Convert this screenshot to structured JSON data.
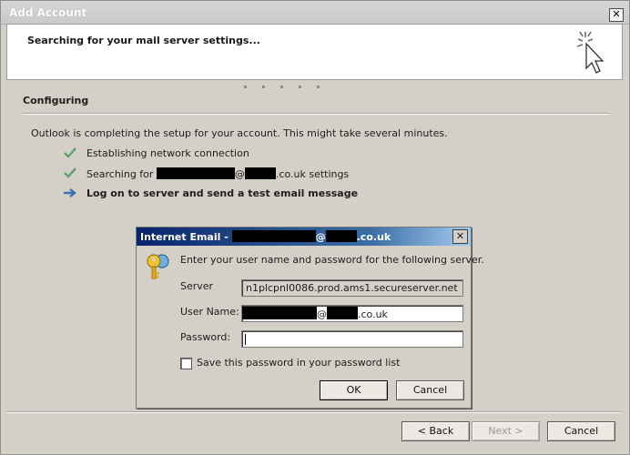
{
  "window": {
    "title": "Add Account",
    "close_glyph": "✕"
  },
  "header": {
    "heading": "Searching for your mail server settings..."
  },
  "section": {
    "title": "Configuring",
    "intro": "Outlook is completing the setup for your account. This might take several minutes."
  },
  "steps": [
    {
      "status": "done",
      "icon": "checkmark-icon",
      "text": "Establishing network connection"
    },
    {
      "status": "done",
      "icon": "checkmark-icon",
      "text_before": "Searching for ",
      "at": "@",
      "text_after": ".co.uk settings"
    },
    {
      "status": "current",
      "icon": "arrow-right-icon",
      "text": "Log on to server and send a test email message"
    }
  ],
  "buttons": {
    "back": "< Back",
    "next": "Next >",
    "cancel": "Cancel"
  },
  "dialog": {
    "title_prefix": "Internet Email - ",
    "title_at": "@",
    "title_suffix": ".co.uk",
    "close_glyph": "✕",
    "prompt": "Enter your user name and password for the following server.",
    "server_label": "Server",
    "server_value": "n1plcpnl0086.prod.ams1.secureserver.net",
    "username_label": "User Name:",
    "username_at": "@",
    "username_suffix": ".co.uk",
    "password_label": "Password:",
    "password_value": "",
    "save_password_label": "Save this password in your password list",
    "save_password_checked": false,
    "ok": "OK",
    "cancel": "Cancel"
  },
  "colors": {
    "check": "#5aa26b",
    "arrow": "#3b6fb6",
    "dialog_title_start": "#0a246a",
    "dialog_title_end": "#a6caf0"
  }
}
